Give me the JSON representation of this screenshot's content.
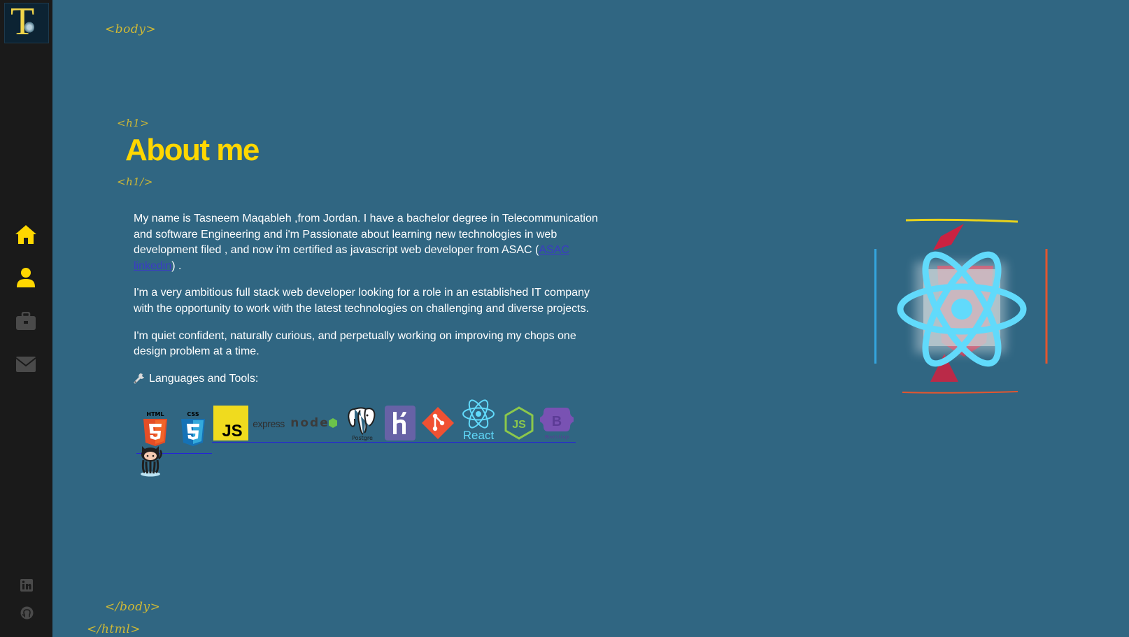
{
  "logo": {
    "letter": "T"
  },
  "nav": [
    {
      "name": "home",
      "color": "#ffd700"
    },
    {
      "name": "about",
      "color": "#ffd700"
    },
    {
      "name": "portfolio",
      "color": "#4a4a4a"
    },
    {
      "name": "contact",
      "color": "#4a4a4a"
    }
  ],
  "tags": {
    "body_open": "<body>",
    "h1_open": "<h1>",
    "h1_close": "<h1/>",
    "body_close": "</body>",
    "html_close": "</html>"
  },
  "heading": "About me",
  "paragraphs": {
    "p1_before": "My name is Tasneem Maqableh ,from Jordan. I have a bachelor degree in Telecommunication and software Engineering and i'm Passionate about learning new technologies in web development filed , and now i'm certified as javascript web developer from ASAC (",
    "p1_link": "ASAC linkedin",
    "p1_after": ") .",
    "p2": "I'm a very ambitious full stack web developer looking for a role in an established IT company with the opportunity to work with the latest technologies on challenging and diverse projects.",
    "p3": "I'm quiet confident, naturally curious, and perpetually working on improving my chops one design problem at a time.",
    "tools_heading": "Languages and Tools:"
  },
  "tools": {
    "html5": "HTML",
    "css3": "CSS",
    "javascript": "JS",
    "express": "express",
    "nodejs": "node",
    "postgresql": "Postgre",
    "heroku": "heroku",
    "git": "git",
    "react": "React",
    "nodejs_hex": "JS",
    "bootstrap": "Bootstrap",
    "github": "github"
  },
  "colors": {
    "background": "#306682",
    "sidebar": "#1a1a1a",
    "accent": "#ffd700",
    "tag": "#d0b935"
  }
}
